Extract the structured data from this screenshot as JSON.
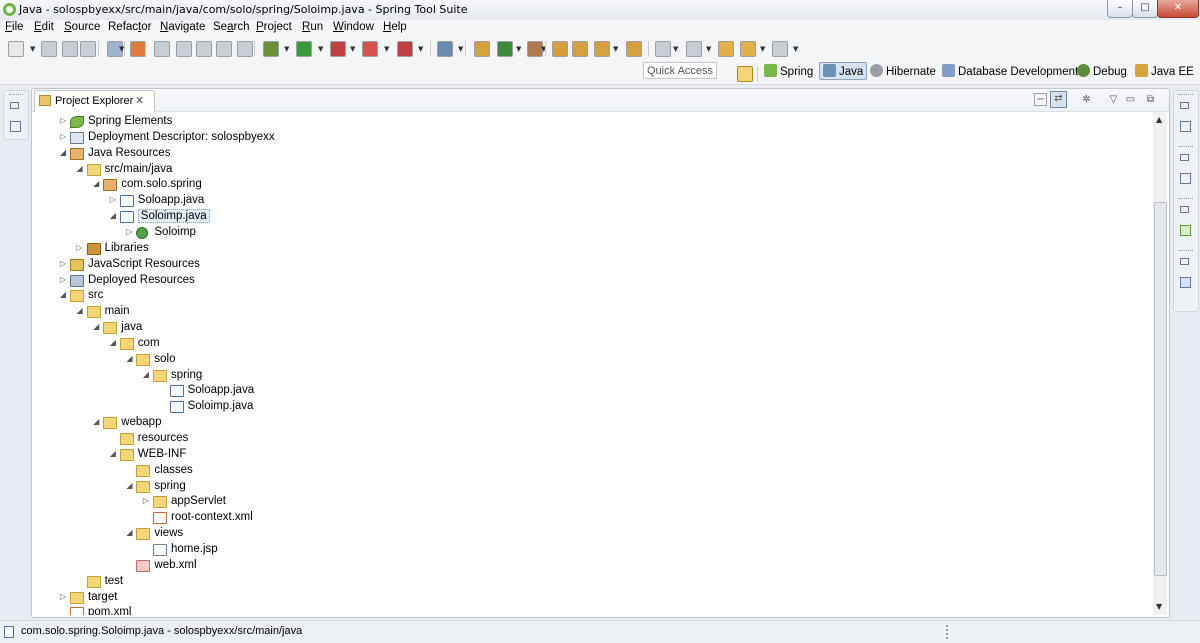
{
  "window": {
    "title": "Java - solospbyexx/src/main/java/com/solo/spring/Soloimp.java - Spring Tool Suite",
    "minimize": "–",
    "maximize": "□",
    "close": "✕"
  },
  "menu": [
    {
      "u": "F",
      "rest": "ile"
    },
    {
      "u": "E",
      "rest": "dit"
    },
    {
      "u": "S",
      "rest": "ource"
    },
    {
      "pre": "Refac",
      "u": "t",
      "rest": "or"
    },
    {
      "u": "N",
      "rest": "avigate"
    },
    {
      "pre": "Se",
      "u": "a",
      "rest": "rch"
    },
    {
      "u": "P",
      "rest": "roject"
    },
    {
      "u": "R",
      "rest": "un"
    },
    {
      "u": "W",
      "rest": "indow"
    },
    {
      "u": "H",
      "rest": "elp"
    }
  ],
  "perspectives": {
    "quick_access": "Quick Access",
    "items": [
      "Spring",
      "Java",
      "Hibernate",
      "Database Development",
      "Debug",
      "Java EE"
    ],
    "active": "Java"
  },
  "view": {
    "tab_label": "Project Explorer",
    "tab_close": "✕"
  },
  "tree": [
    {
      "label": "Spring Elements",
      "toggle": "closed",
      "icon": "spring"
    },
    {
      "label": "Deployment Descriptor: solospbyexx",
      "toggle": "closed",
      "icon": "dd"
    },
    {
      "label": "Java Resources",
      "toggle": "open",
      "icon": "package"
    },
    {
      "label": "src/main/java",
      "toggle": "open",
      "icon": "srcfolder"
    },
    {
      "label": "com.solo.spring",
      "toggle": "open",
      "icon": "package"
    },
    {
      "label": "Soloapp.java",
      "toggle": "closed",
      "icon": "java"
    },
    {
      "label": "Soloimp.java",
      "toggle": "open",
      "icon": "java",
      "selected": true
    },
    {
      "label": "Soloimp",
      "toggle": "closed",
      "icon": "class"
    },
    {
      "label": "Libraries",
      "toggle": "closed",
      "icon": "lib"
    },
    {
      "label": "JavaScript Resources",
      "toggle": "closed",
      "icon": "js"
    },
    {
      "label": "Deployed Resources",
      "toggle": "closed",
      "icon": "deployed"
    },
    {
      "label": "src",
      "toggle": "open",
      "icon": "folder"
    },
    {
      "label": "main",
      "toggle": "open",
      "icon": "folder"
    },
    {
      "label": "java",
      "toggle": "open",
      "icon": "folder"
    },
    {
      "label": "com",
      "toggle": "open",
      "icon": "folder"
    },
    {
      "label": "solo",
      "toggle": "open",
      "icon": "folder"
    },
    {
      "label": "spring",
      "toggle": "open",
      "icon": "folder"
    },
    {
      "label": "Soloapp.java",
      "toggle": "none",
      "icon": "java"
    },
    {
      "label": "Soloimp.java",
      "toggle": "none",
      "icon": "java"
    },
    {
      "label": "webapp",
      "toggle": "open",
      "icon": "folder"
    },
    {
      "label": "resources",
      "toggle": "none",
      "icon": "folder"
    },
    {
      "label": "WEB-INF",
      "toggle": "open",
      "icon": "folder"
    },
    {
      "label": "classes",
      "toggle": "none",
      "icon": "folder"
    },
    {
      "label": "spring",
      "toggle": "open",
      "icon": "folder"
    },
    {
      "label": "appServlet",
      "toggle": "closed",
      "icon": "folder"
    },
    {
      "label": "root-context.xml",
      "toggle": "none",
      "icon": "xml"
    },
    {
      "label": "views",
      "toggle": "open",
      "icon": "folder"
    },
    {
      "label": "home.jsp",
      "toggle": "none",
      "icon": "jsp"
    },
    {
      "label": "web.xml",
      "toggle": "none",
      "icon": "web"
    },
    {
      "label": "test",
      "toggle": "none",
      "icon": "folder"
    },
    {
      "label": "target",
      "toggle": "closed",
      "icon": "folder"
    },
    {
      "label": "pom.xml",
      "toggle": "none",
      "icon": "xml"
    }
  ],
  "status": {
    "text": "com.solo.spring.Soloimp.java - solospbyexx/src/main/java"
  }
}
